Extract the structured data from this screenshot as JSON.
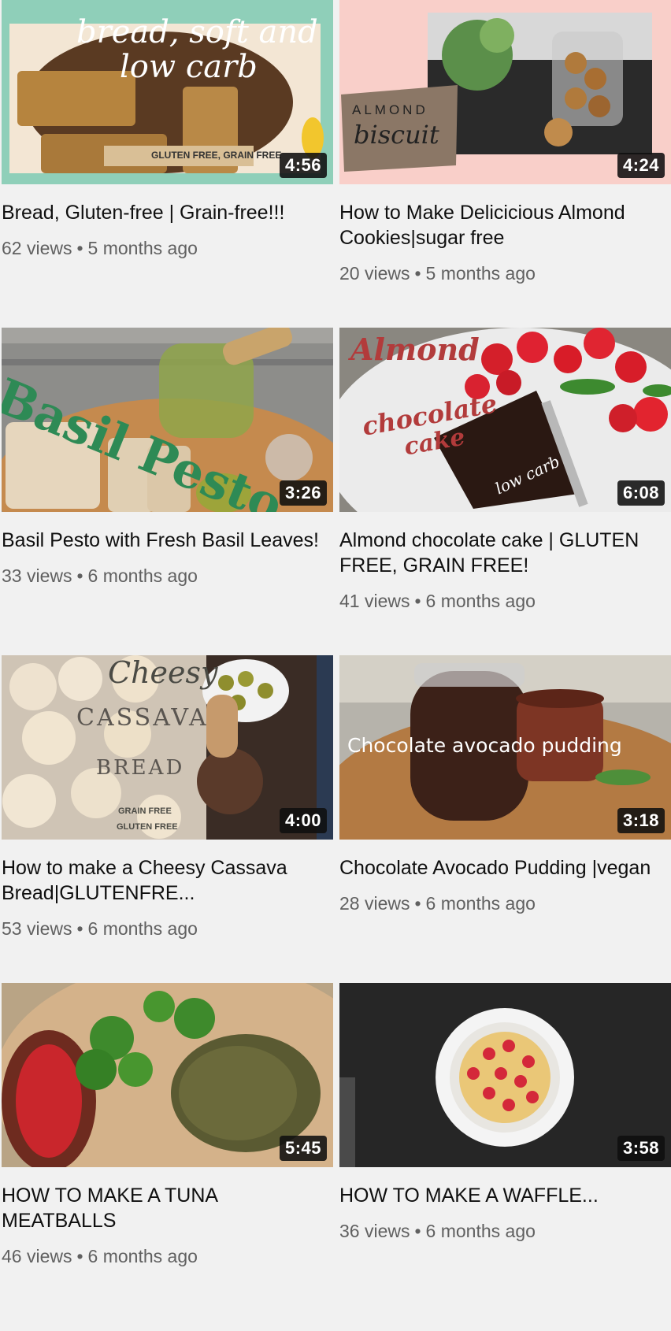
{
  "videos": [
    {
      "title": "Bread, Gluten-free | Grain-free!!!",
      "views": "62 views",
      "age": "5 months ago",
      "duration": "4:56",
      "thumb_text": [
        "bread, soft and",
        "low carb",
        "GLUTEN FREE, GRAIN FREE"
      ]
    },
    {
      "title": "How to Make Delicicious Almond Cookies|sugar free",
      "views": "20 views",
      "age": "5 months ago",
      "duration": "4:24",
      "thumb_text": [
        "ALMOND",
        "biscuit"
      ]
    },
    {
      "title": "Basil Pesto with Fresh Basil Leaves!",
      "views": "33 views",
      "age": "6 months ago",
      "duration": "3:26",
      "thumb_text": [
        "Basil Pesto"
      ]
    },
    {
      "title": "Almond chocolate cake | GLUTEN FREE, GRAIN FREE!",
      "views": "41 views",
      "age": "6 months ago",
      "duration": "6:08",
      "thumb_text": [
        "Almond",
        "chocolate",
        "cake",
        "low carb"
      ]
    },
    {
      "title": "How to make a Cheesy Cassava Bread|GLUTENFRE...",
      "views": "53 views",
      "age": "6 months ago",
      "duration": "4:00",
      "thumb_text": [
        "Cheesy",
        "CASSAVA",
        "BREAD",
        "GRAIN FREE",
        "GLUTEN FREE"
      ]
    },
    {
      "title": "Chocolate Avocado Pudding |vegan",
      "views": "28 views",
      "age": "6 months ago",
      "duration": "3:18",
      "thumb_text": [
        "Chocolate avocado pudding"
      ]
    },
    {
      "title": "HOW TO MAKE A TUNA MEATBALLS",
      "views": "46 views",
      "age": "6 months ago",
      "duration": "5:45",
      "thumb_text": []
    },
    {
      "title": "HOW TO MAKE A WAFFLE...",
      "views": "36 views",
      "age": "6 months ago",
      "duration": "3:58",
      "thumb_text": []
    }
  ],
  "separator": "•"
}
